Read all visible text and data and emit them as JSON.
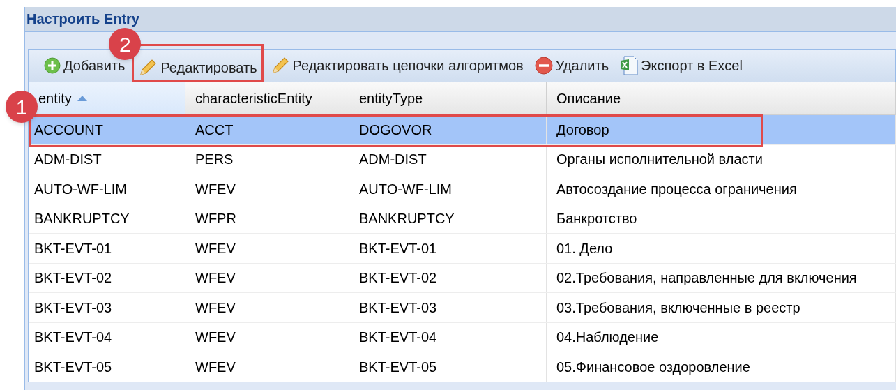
{
  "panel": {
    "title": "Настроить Entry"
  },
  "toolbar": [
    {
      "kind": "add",
      "label": "Добавить"
    },
    {
      "kind": "edit",
      "label": "Редактировать"
    },
    {
      "kind": "edit",
      "label": "Редактировать цепочки алгоритмов"
    },
    {
      "kind": "delete",
      "label": "Удалить"
    },
    {
      "kind": "excel",
      "label": "Экспорт в Excel"
    }
  ],
  "table": {
    "columns": [
      {
        "label": "entity",
        "sorted": true
      },
      {
        "label": "characteristicEntity",
        "sorted": false
      },
      {
        "label": "entityType",
        "sorted": false
      },
      {
        "label": "Описание",
        "sorted": false
      }
    ],
    "rows": [
      {
        "selected": true,
        "cells": [
          "ACCOUNT",
          "ACCT",
          "DOGOVOR",
          "Договор"
        ]
      },
      {
        "selected": false,
        "cells": [
          "ADM-DIST",
          "PERS",
          "ADM-DIST",
          "Органы исполнительной власти"
        ]
      },
      {
        "selected": false,
        "cells": [
          "AUTO-WF-LIM",
          "WFEV",
          "AUTO-WF-LIM",
          "Автосоздание процесса ограничения"
        ]
      },
      {
        "selected": false,
        "cells": [
          "BANKRUPTCY",
          "WFPR",
          "BANKRUPTCY",
          "Банкротство"
        ]
      },
      {
        "selected": false,
        "cells": [
          "BKT-EVT-01",
          "WFEV",
          "BKT-EVT-01",
          "01. Дело"
        ]
      },
      {
        "selected": false,
        "cells": [
          "BKT-EVT-02",
          "WFEV",
          "BKT-EVT-02",
          "02.Требования, направленные для включения"
        ]
      },
      {
        "selected": false,
        "cells": [
          "BKT-EVT-03",
          "WFEV",
          "BKT-EVT-03",
          "03.Требования, включенные в реестр"
        ]
      },
      {
        "selected": false,
        "cells": [
          "BKT-EVT-04",
          "WFEV",
          "BKT-EVT-04",
          "04.Наблюдение"
        ]
      },
      {
        "selected": false,
        "cells": [
          "BKT-EVT-05",
          "WFEV",
          "BKT-EVT-05",
          "05.Финансовое оздоровление"
        ]
      }
    ]
  },
  "annotations": [
    {
      "label": "1"
    },
    {
      "label": "2"
    }
  ]
}
